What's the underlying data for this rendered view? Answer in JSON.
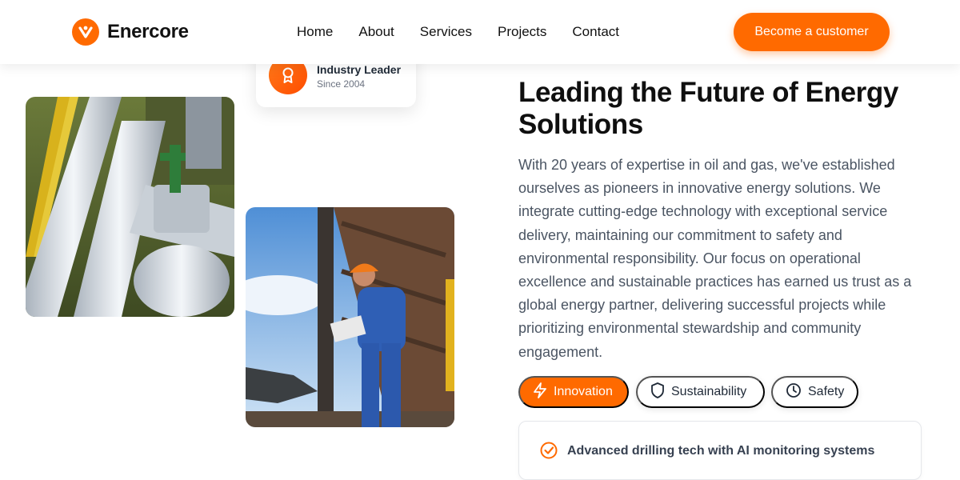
{
  "nav": {
    "brand": "Enercore",
    "links": [
      "Home",
      "About",
      "Services",
      "Projects",
      "Contact"
    ],
    "cta": "Become a customer"
  },
  "badge": {
    "title": "Industry Leader",
    "subtitle": "Since 2004",
    "icon": "award-icon"
  },
  "hero": {
    "headline": "Leading the Future of Energy Solutions",
    "paragraph": "With 20 years of expertise in oil and gas, we've established ourselves as pioneers in innovative energy solutions. We integrate cutting-edge technology with exceptional service delivery, maintaining our commitment to safety and environmental responsibility. Our focus on operational excellence and sustainable practices has earned us trust as a global energy partner, delivering successful projects while prioritizing environmental stewardship and community engagement."
  },
  "tabs": [
    {
      "label": "Innovation",
      "icon": "lightning-icon",
      "active": true
    },
    {
      "label": "Sustainability",
      "icon": "shield-icon",
      "active": false
    },
    {
      "label": "Safety",
      "icon": "clock-icon",
      "active": false
    }
  ],
  "feature": {
    "text": "Advanced drilling tech with AI monitoring systems",
    "icon": "check-circle-icon"
  },
  "colors": {
    "accent": "#ff6a00",
    "text": "#111111",
    "muted": "#4b5563"
  }
}
